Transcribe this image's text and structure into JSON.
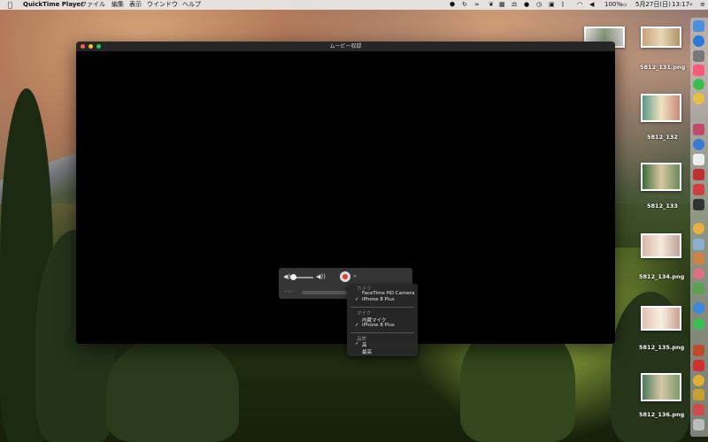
{
  "menubar": {
    "apple": "",
    "app_name": "QuickTime Player",
    "items": [
      "ファイル",
      "編集",
      "表示",
      "ウインドウ",
      "ヘルプ"
    ],
    "battery": "100%",
    "date": "5月27日(日)",
    "time": "13:17"
  },
  "window": {
    "title": "ムービー収録",
    "colors": {
      "close": "#ff5f57",
      "minimize": "#febc2e",
      "zoom": "#28c840"
    }
  },
  "controls": {
    "time_readout": "--:--",
    "record_color": "#e03b32"
  },
  "record_menu": {
    "camera_header": "カメラ",
    "cameras": [
      {
        "label": "FaceTime HD Camera",
        "checked": false
      },
      {
        "label": "iPhone 8 Plus",
        "checked": true
      }
    ],
    "mic_header": "マイク",
    "mics": [
      {
        "label": "内蔵マイク",
        "checked": false
      },
      {
        "label": "iPhone 8 Plus",
        "checked": true
      }
    ],
    "quality_header": "品質",
    "qualities": [
      {
        "label": "高",
        "checked": true
      },
      {
        "label": "最高",
        "checked": false
      }
    ],
    "checkmark": "✓"
  },
  "desktop_files": [
    {
      "label": "5812_131.png"
    },
    {
      "label": "5812_132"
    },
    {
      "label": "5812_133"
    },
    {
      "label": "5812_134.png"
    },
    {
      "label": "5812_135.png"
    },
    {
      "label": "5812_136.png"
    }
  ]
}
